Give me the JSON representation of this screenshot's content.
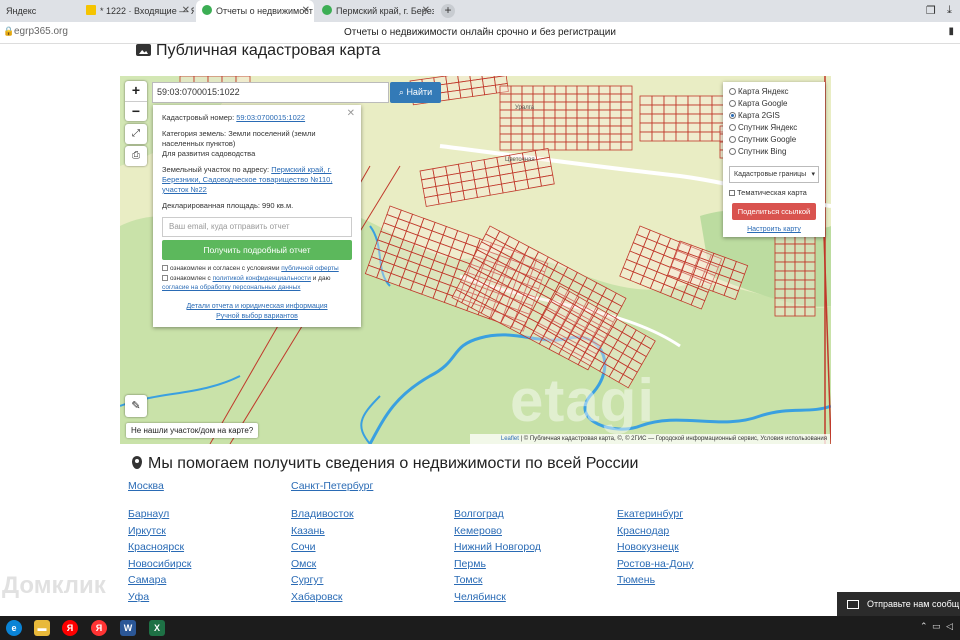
{
  "browser": {
    "tabs": [
      {
        "label": "Яндекс"
      },
      {
        "label": "* 1222 · Входящие — Янд"
      },
      {
        "label": "Отчеты о недвижимост"
      },
      {
        "label": "Пермский край, г. Березн"
      }
    ],
    "url": "egrp365.org",
    "page_title": "Отчеты о недвижимости онлайн срочно и без регистрации"
  },
  "page": {
    "title": "Публичная кадастровая карта"
  },
  "map": {
    "search_value": "59:03:0700015:1022",
    "find_label": "Найти",
    "zoom_in": "+",
    "zoom_out": "−",
    "watermark": "etagi",
    "not_found": "Не нашли участок/дом на карте?",
    "attribution_leaflet": "Leaflet",
    "attribution_rest": " | © Публичная кадастровая карта, ©, © 2ГИС — Городской информационный сервис, Условия использования",
    "popup": {
      "cad_label": "Кадастровый номер:",
      "cad_value": "59:03:0700015:1022",
      "cat_label": "Категория земель:",
      "cat_value": "Земли поселений (земли населенных пунктов)",
      "use_value": "Для развития садоводства",
      "addr_label": "Земельный участок по адресу:",
      "addr_value": "Пермский край, г. Березники, Садоводческое товарищество №110, участок №22",
      "area_label": "Декларированная площадь:",
      "area_value": "990 кв.м.",
      "email_placeholder": "Ваш email, куда отправить отчет",
      "report_button": "Получить подробный отчет",
      "agree1_text": "ознакомлен и согласен с условиями",
      "agree1_link": "публичной оферты",
      "agree2_text": "ознакомлен с",
      "agree2_link": "политикой конфиденциальности",
      "agree2_mid": "и даю",
      "agree2_link2": "согласие на обработку персональных данных",
      "details_link": "Детали отчета и юридическая информация",
      "manual_link": "Ручной выбор вариантов"
    },
    "layers": {
      "options": [
        {
          "label": "Карта Яндекс",
          "checked": false
        },
        {
          "label": "Карта Google",
          "checked": false
        },
        {
          "label": "Карта 2GIS",
          "checked": true
        },
        {
          "label": "Спутник Яндекс",
          "checked": false
        },
        {
          "label": "Спутник Google",
          "checked": false
        },
        {
          "label": "Спутник Bing",
          "checked": false
        }
      ],
      "select_value": "Кадастровые границы",
      "thematic_label": "Тематическая карта",
      "share_label": "Поделиться ссылкой",
      "configure_label": "Настроить карту"
    }
  },
  "help": {
    "title": "Мы помогаем получить сведения о недвижимости по всей России",
    "top_cities": [
      "Москва",
      "Санкт-Петербург"
    ],
    "cities": [
      [
        "Барнаул",
        "Владивосток",
        "Волгоград",
        "Екатеринбург"
      ],
      [
        "Иркутск",
        "Казань",
        "Кемерово",
        "Краснодар"
      ],
      [
        "Красноярск",
        "Сочи",
        "Нижний Новгород",
        "Новокузнецк"
      ],
      [
        "Новосибирск",
        "Омск",
        "Пермь",
        "Ростов-на-Дону"
      ],
      [
        "Самара",
        "Сургут",
        "Томск",
        "Тюмень"
      ],
      [
        "Уфа",
        "Хабаровск",
        "Челябинск",
        ""
      ]
    ]
  },
  "overlay_watermark": "Домклик",
  "notification": "Отправьте нам сообщ",
  "taskbar": {
    "icons": [
      "edge-icon",
      "folder-icon",
      "yandex-icon",
      "yandex-browser-icon",
      "word-icon",
      "excel-icon"
    ]
  }
}
